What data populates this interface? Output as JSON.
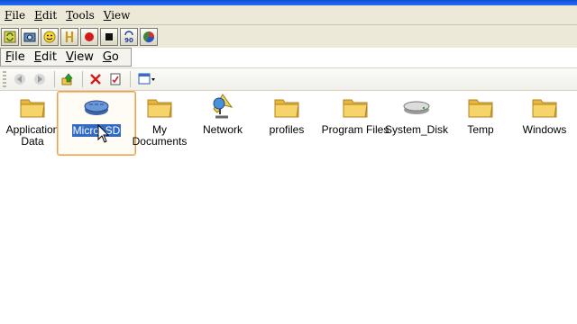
{
  "outer_menu": [
    "File",
    "Edit",
    "Tools",
    "View"
  ],
  "outer_toolbar": [
    "refresh-icon",
    "camera-icon",
    "smiley-icon",
    "key-icon",
    "record-icon",
    "stop-icon",
    "rotate-90-icon",
    "pie-icon"
  ],
  "rotate_label": "90",
  "inner_menu": [
    "File",
    "Edit",
    "View",
    "Go"
  ],
  "nav_toolbar": [
    "back-icon",
    "forward-icon",
    "up-icon",
    "delete-icon",
    "properties-icon",
    "view-mode-icon"
  ],
  "items": [
    {
      "label": "Application Data",
      "icon": "folder-icon"
    },
    {
      "label": "Micro_SD",
      "icon": "storage-card-icon",
      "selected": true
    },
    {
      "label": "My Documents",
      "icon": "folder-icon"
    },
    {
      "label": "Network",
      "icon": "network-icon"
    },
    {
      "label": "profiles",
      "icon": "folder-icon"
    },
    {
      "label": "Program Files",
      "icon": "folder-icon"
    },
    {
      "label": "System_Disk",
      "icon": "disk-icon"
    },
    {
      "label": "Temp",
      "icon": "folder-icon"
    },
    {
      "label": "Windows",
      "icon": "folder-icon"
    }
  ],
  "colors": {
    "selection": "#316ac5",
    "selection_border": "#f0a04a",
    "folder": "#f3c94f",
    "menubar": "#ece9d8"
  }
}
